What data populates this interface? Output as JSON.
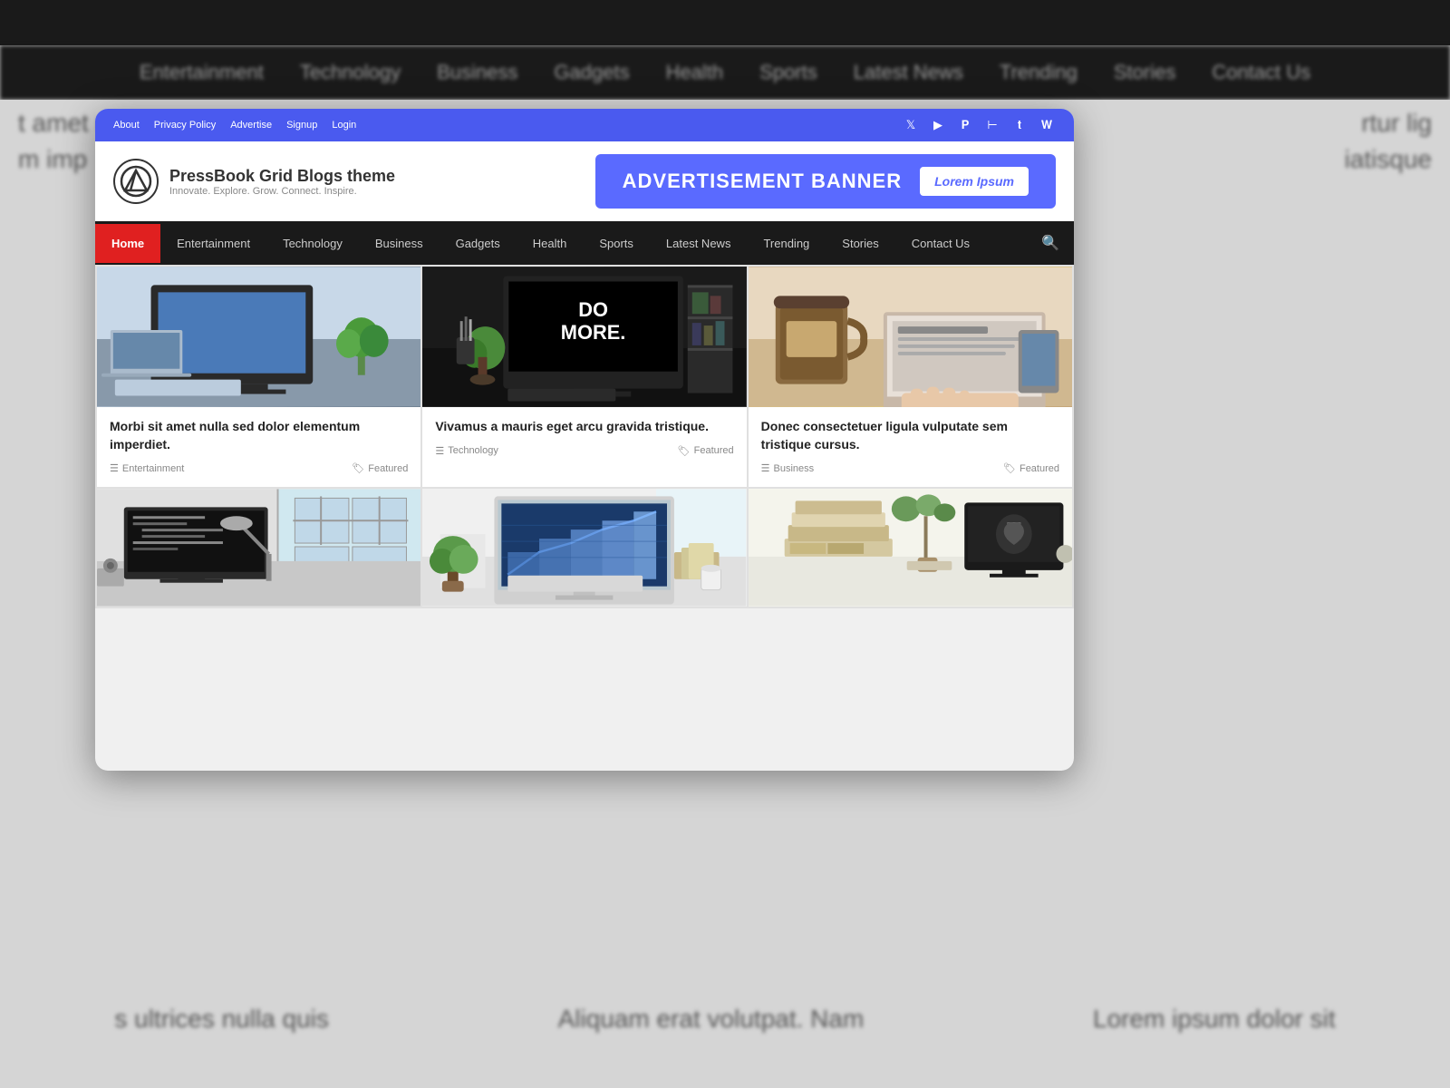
{
  "site": {
    "logo_text": "PressBook Grid Blogs theme",
    "logo_tagline": "Innovate. Explore. Grow. Connect. Inspire.",
    "logo_icon": "⊿"
  },
  "utility_bar": {
    "links": [
      "About",
      "Privacy Policy",
      "Advertise",
      "Signup",
      "Login"
    ],
    "social_icons": [
      "twitter",
      "youtube",
      "pinterest",
      "medium",
      "tumblr",
      "wordpress"
    ]
  },
  "advertisement": {
    "text": "ADVERTISEMENT BANNER",
    "button_label": "Lorem Ipsum"
  },
  "navigation": {
    "items": [
      {
        "label": "Home",
        "active": true
      },
      {
        "label": "Entertainment",
        "active": false
      },
      {
        "label": "Technology",
        "active": false
      },
      {
        "label": "Business",
        "active": false
      },
      {
        "label": "Gadgets",
        "active": false
      },
      {
        "label": "Health",
        "active": false
      },
      {
        "label": "Sports",
        "active": false
      },
      {
        "label": "Latest News",
        "active": false
      },
      {
        "label": "Trending",
        "active": false
      },
      {
        "label": "Stories",
        "active": false
      },
      {
        "label": "Contact Us",
        "active": false
      }
    ]
  },
  "bg_nav": {
    "items": [
      "Entertainment",
      "Technology",
      "Business",
      "Gadgets",
      "Health",
      "Sports",
      "Latest News",
      "Trending",
      "Stories",
      "Contact Us"
    ]
  },
  "cards": [
    {
      "title": "Morbi sit amet nulla sed dolor elementum imperdiet.",
      "category": "Entertainment",
      "featured": "Featured",
      "img_type": "desk1"
    },
    {
      "title": "Vivamus a mauris eget arcu gravida tristique.",
      "category": "Technology",
      "featured": "Featured",
      "img_type": "desk2"
    },
    {
      "title": "Donec consectetuer ligula vulputate sem tristique cursus.",
      "category": "Business",
      "featured": "Featured",
      "img_type": "coffee"
    }
  ],
  "bottom_cards": [
    {
      "img_type": "desk3"
    },
    {
      "img_type": "monitor"
    },
    {
      "img_type": "books"
    }
  ],
  "colors": {
    "accent": "#4a5aef",
    "nav_bg": "#1a1a1a",
    "active_nav": "#e02020"
  }
}
